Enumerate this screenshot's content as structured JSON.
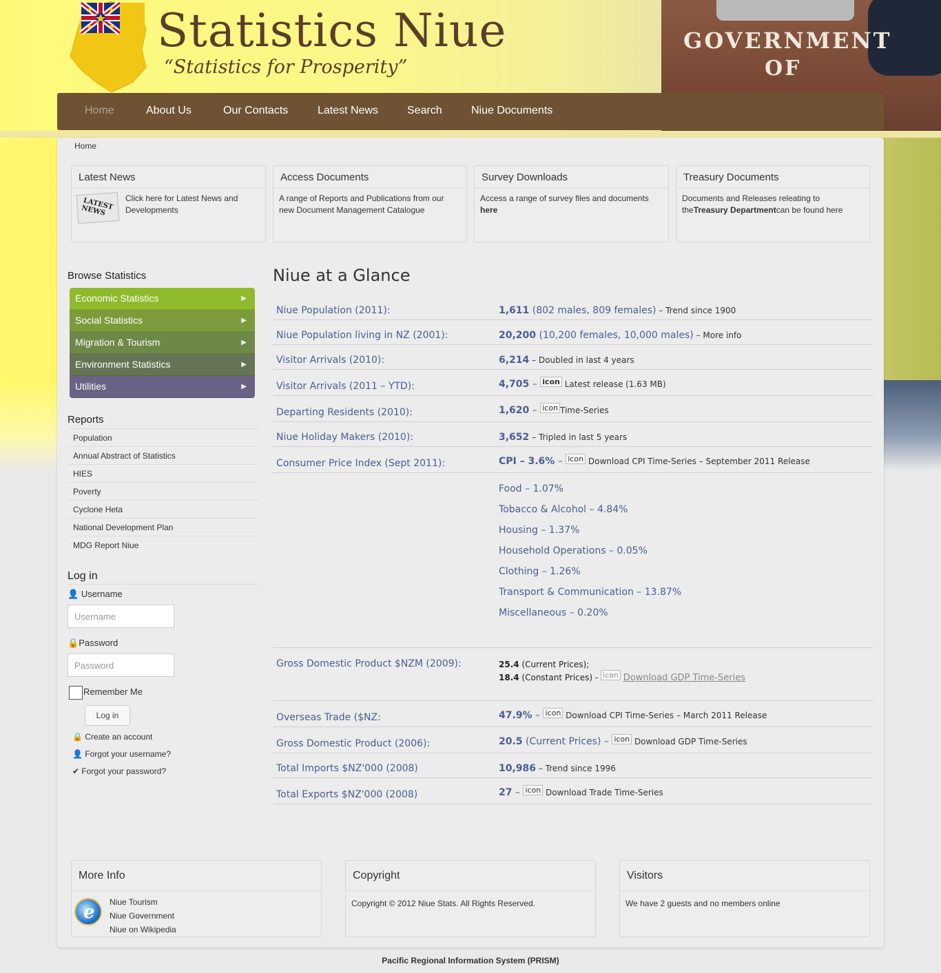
{
  "header": {
    "site_title": "Statistics Niue",
    "tagline": "“Statistics for Prosperity”",
    "sign_line1": "GOVERNMENT",
    "sign_line2": "OF"
  },
  "nav": {
    "items": [
      "Home",
      "About Us",
      "Our Contacts",
      "Latest News",
      "Search",
      "Niue Documents"
    ],
    "active": "Home"
  },
  "breadcrumb": "Home",
  "modules": [
    {
      "title": "Latest News",
      "text": "Click here for Latest News and Developments",
      "image_text": "LATEST NEWS"
    },
    {
      "title": "Access Documents",
      "text": "A range of Reports and Publications from our new Document Management Catalogue"
    },
    {
      "title": "Survey Downloads",
      "text_before": "Access a range of survey files and documents ",
      "text_bold": "here"
    },
    {
      "title": "Treasury Documents",
      "text_before": "Documents and Releases releating to the",
      "text_bold": "Treasury Department",
      "text_after": "can be found here"
    }
  ],
  "browse": {
    "title": "Browse Statistics",
    "items": [
      "Economic Statistics",
      "Social Statistics",
      "Migration & Tourism",
      "Environment Statistics",
      "Utilities"
    ],
    "colors": [
      "#8fba2b",
      "#7c9b3b",
      "#6d8847",
      "#657454",
      "#6a6284"
    ]
  },
  "reports": {
    "title": "Reports",
    "items": [
      "Population",
      "Annual Abstract of Statistics",
      "HIES",
      "Poverty",
      "Cyclone Heta",
      "National Development Plan",
      "MDG Report Niue"
    ]
  },
  "login": {
    "title": "Log in",
    "username_label": "Username",
    "username_placeholder": "Username",
    "password_label": "Password",
    "password_placeholder": "Password",
    "remember_label": "Remember Me",
    "button": "Log in",
    "links": [
      "Create an account",
      "Forgot your username?",
      "Forgot your password?"
    ]
  },
  "glance": {
    "title": "Niue at a Glance",
    "icon_placeholder": "icon",
    "rows": [
      {
        "label": "Niue Population (2011):",
        "value": "1,611",
        "detail": " (802 males, 809 females)",
        "note": " – Trend since 1900"
      },
      {
        "label": "Niue Population living in NZ (2001):",
        "value": "20,200",
        "detail": " (10,200 females, 10,000 males)",
        "note": " – More info"
      },
      {
        "label": "Visitor Arrivals (2010):",
        "value": "6,214",
        "detail": "",
        "note": " –  Doubled in last 4 years"
      },
      {
        "label": "Visitor Arrivals (2011 – YTD):",
        "value": "4,705",
        "detail": " – ",
        "note": " Latest release (1.63 MB)"
      },
      {
        "label": "Departing Residents (2010):",
        "value": "1,620",
        "detail": " – ",
        "note": "Time-Series"
      },
      {
        "label": "Niue Holiday Makers (2010):",
        "value": "3,652",
        "detail": "",
        "note": " – Tripled in last 5 years"
      },
      {
        "label": "Consumer Price Index (Sept 2011):",
        "value": "CPI – 3.6%",
        "detail": " – ",
        "note": " Download CPI Time-Series – September 2011 Release"
      }
    ],
    "cpi_items": [
      "Food – 1.07%",
      "Tobacco & Alcohol – 4.84%",
      "Housing – 1.37%",
      "Household Operations – 0.05%",
      "Clothing – 1.26%",
      "Transport & Communication – 13.87%",
      "Miscellaneous – 0.20%"
    ],
    "gdp": {
      "label": "Gross Domestic Product $NZM (2009):",
      "current_value": "25.4",
      "current_text": " (Current Prices);",
      "constant_value": "18.4",
      "constant_text": " (Constant Prices) - ",
      "link": "Download GDP Time-Series"
    },
    "rows2": [
      {
        "label": "Overseas Trade ($NZ:",
        "value": "47.9%",
        "detail": " – ",
        "note": " Download CPI Time-Series – March 2011 Release"
      },
      {
        "label": "Gross Domestic Product (2006):",
        "value": "20.5",
        "detail": " (Current Prices) – ",
        "note": " Download GDP Time-Series"
      },
      {
        "label": "Total Imports $NZ'000 (2008)",
        "value": "10,986",
        "detail": "",
        "note": " – Trend since 1996"
      },
      {
        "label": "Total Exports $NZ'000 (2008)",
        "value": "27",
        "detail": " – ",
        "note": " Download Trade Time-Series"
      }
    ]
  },
  "bottom": {
    "more_info": {
      "title": "More Info",
      "links": [
        "Niue Tourism",
        "Niue Government",
        "Niue on Wikipedia"
      ]
    },
    "copyright": {
      "title": "Copyright",
      "text": "Copyright © 2012 Niue Stats. All Rights Reserved."
    },
    "visitors": {
      "title": "Visitors",
      "text": "We have 2 guests and no members online"
    }
  },
  "footer": "Pacific Regional Information System (PRISM)"
}
